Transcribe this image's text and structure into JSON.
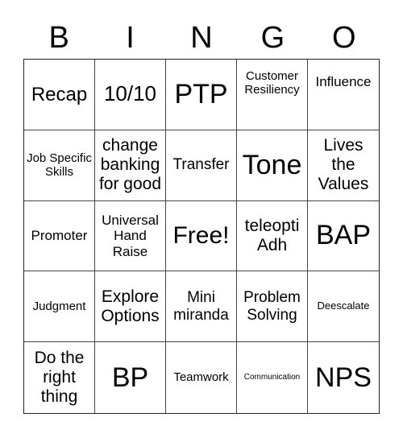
{
  "header": {
    "letters": [
      "B",
      "I",
      "N",
      "G",
      "O"
    ]
  },
  "board": {
    "cells": [
      "Recap",
      "10/10",
      "PTP",
      "Customer Resiliency",
      "Influence",
      "Job Specific Skills",
      "change banking for good",
      "Transfer",
      "Tone",
      "Lives the Values",
      "Promoter",
      "Universal Hand Raise",
      "Free!",
      "teleopti Adh",
      "BAP",
      "Judgment",
      "Explore Options",
      "Mini miranda",
      "Problem Solving",
      "Deescalate",
      "Do the right thing",
      "BP",
      "Teamwork",
      "Communication",
      "NPS"
    ],
    "free_space_index": 12
  }
}
